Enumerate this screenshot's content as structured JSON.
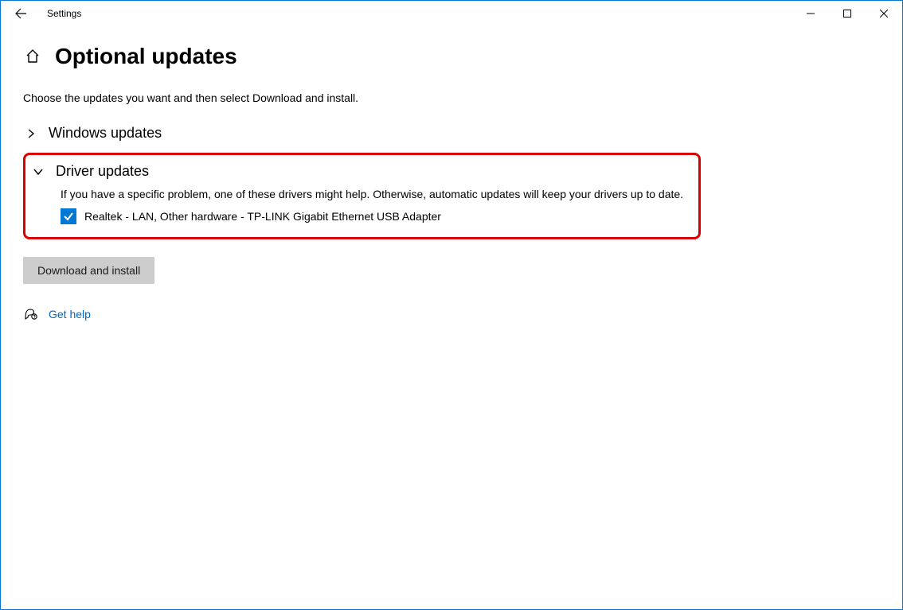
{
  "window": {
    "app_name": "Settings"
  },
  "page": {
    "title": "Optional updates",
    "instruction": "Choose the updates you want and then select Download and install."
  },
  "sections": {
    "windows_updates": {
      "title": "Windows updates",
      "expanded": false
    },
    "driver_updates": {
      "title": "Driver updates",
      "expanded": true,
      "description": "If you have a specific problem, one of these drivers might help. Otherwise, automatic updates will keep your drivers up to date.",
      "items": [
        {
          "label": "Realtek - LAN, Other hardware - TP-LINK Gigabit Ethernet USB Adapter",
          "checked": true
        }
      ]
    }
  },
  "actions": {
    "download_install": "Download and install"
  },
  "help": {
    "label": "Get help"
  },
  "colors": {
    "accent": "#0078d4",
    "highlight_border": "#d80000",
    "link": "#0067c0"
  }
}
